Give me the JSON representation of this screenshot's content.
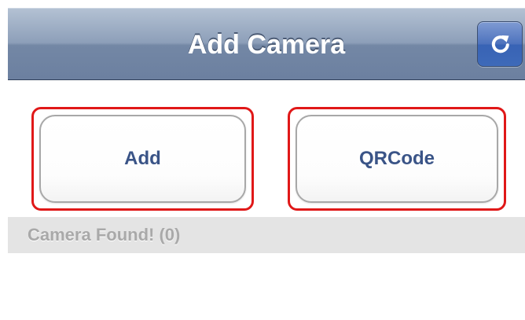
{
  "navbar": {
    "title": "Add Camera",
    "refresh_icon": "refresh-icon"
  },
  "buttons": {
    "add_label": "Add",
    "qrcode_label": "QRCode"
  },
  "highlight_color": "#e01818",
  "section": {
    "header": "Camera Found! (0)"
  }
}
